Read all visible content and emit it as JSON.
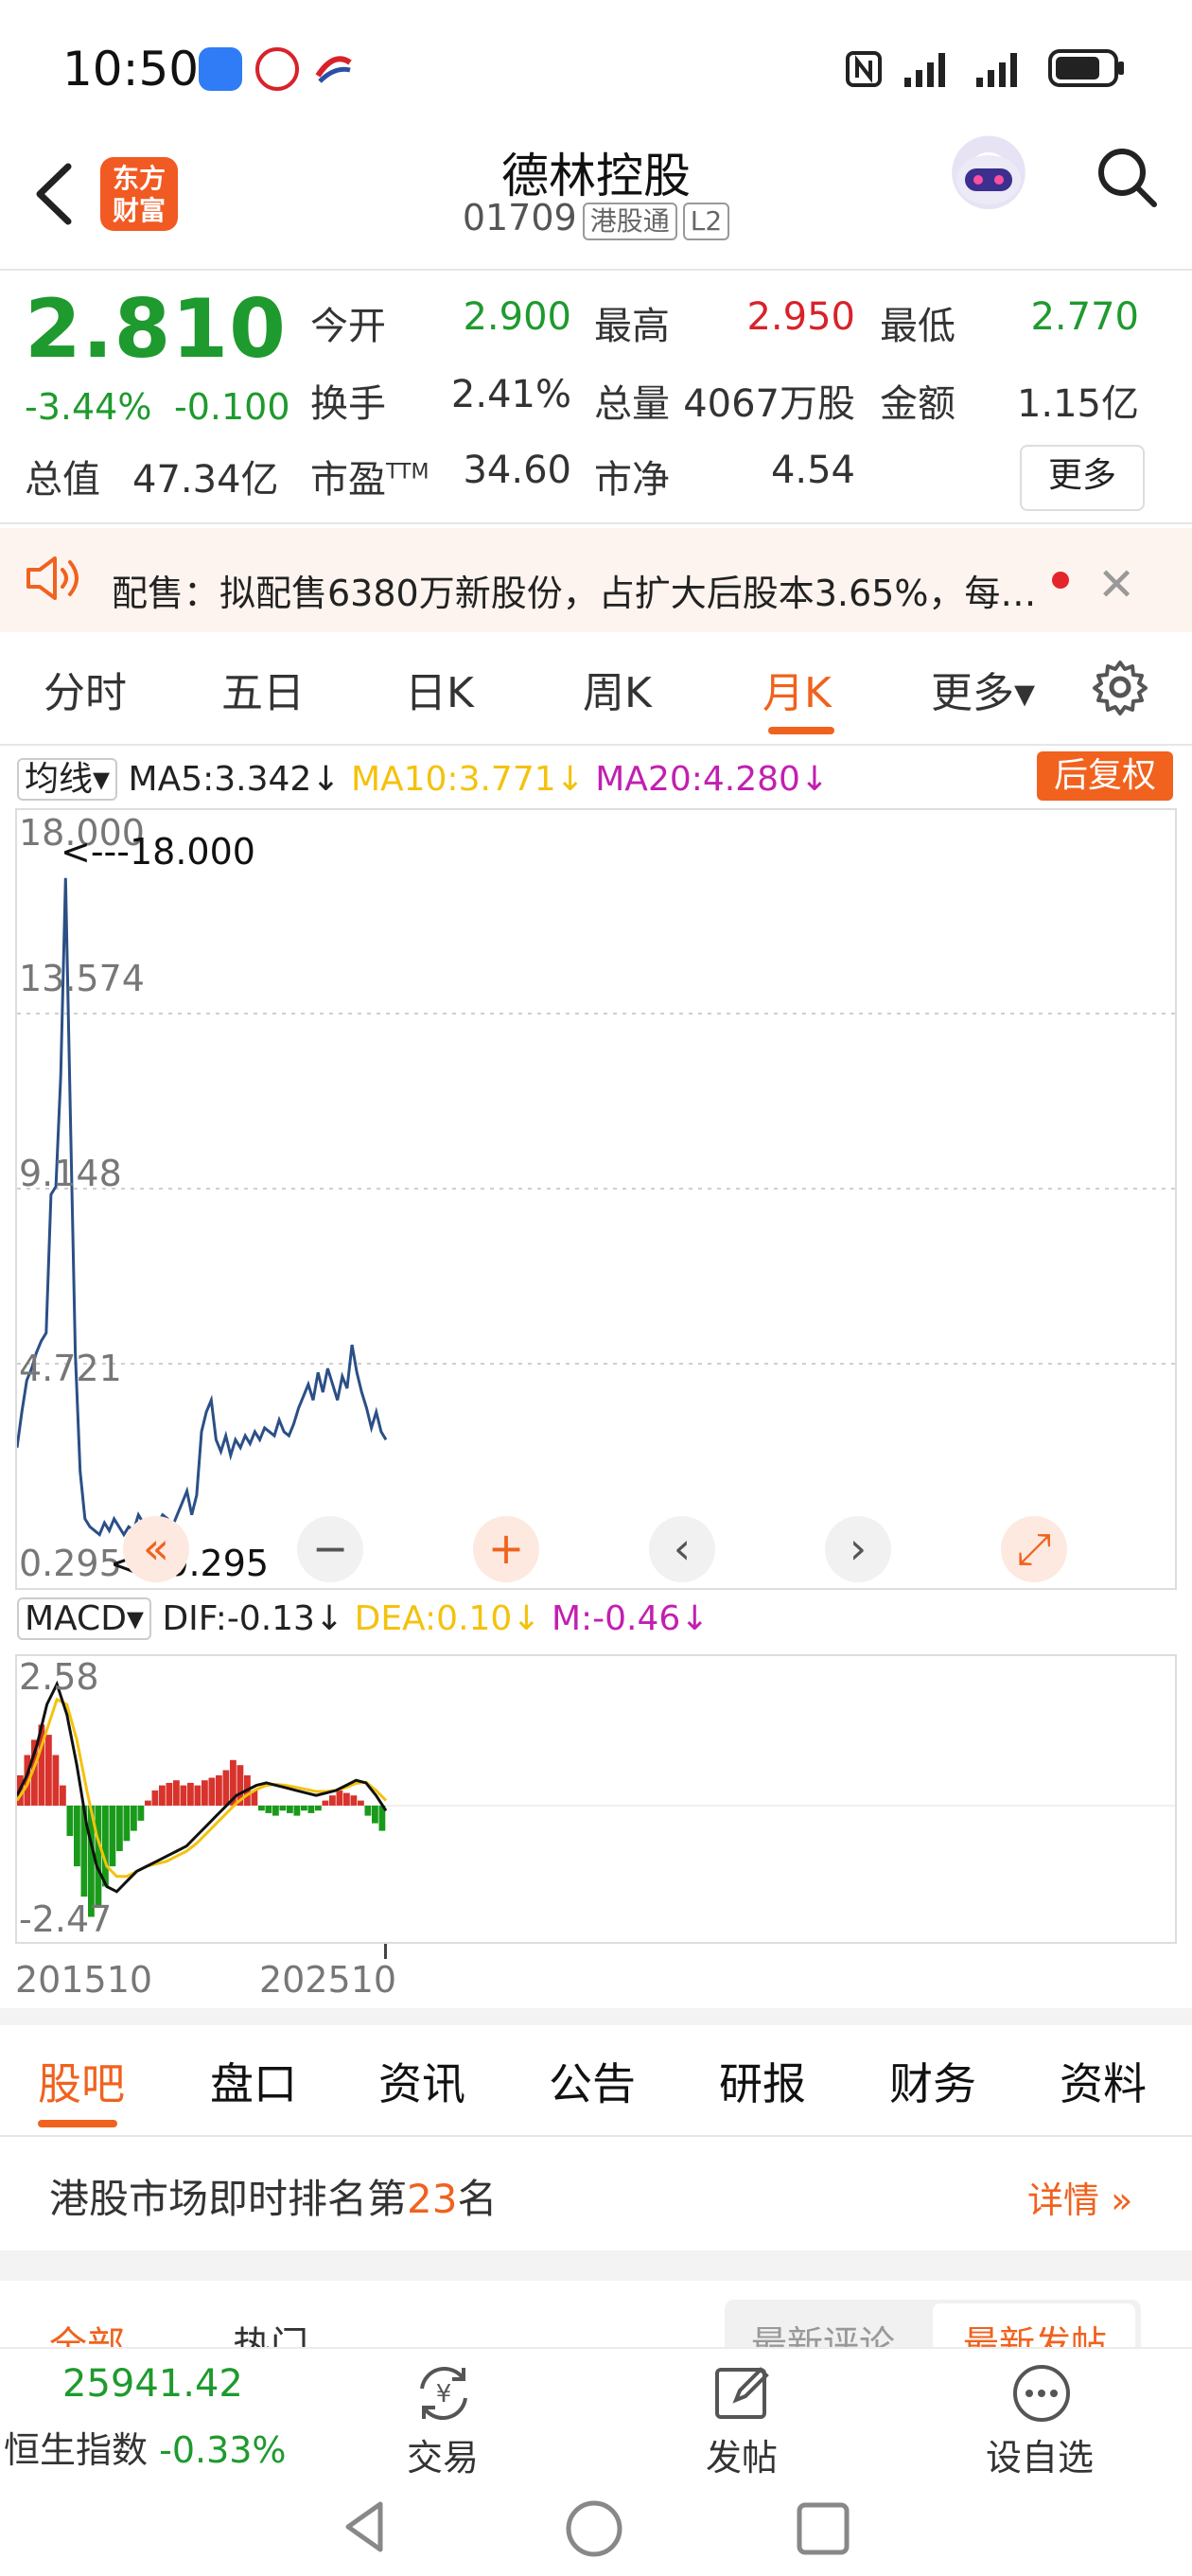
{
  "status_bar": {
    "time": "10:50"
  },
  "header": {
    "logo_line1": "东方",
    "logo_line2": "财富",
    "title": "德林控股",
    "code": "01709",
    "tags": [
      "港股通",
      "L2"
    ]
  },
  "quote": {
    "price": "2.810",
    "change_pct": "-3.44%",
    "change_amt": "-0.100",
    "fields": [
      {
        "label": "今开",
        "value": "2.900",
        "color": "#1e9a2e"
      },
      {
        "label": "最高",
        "value": "2.950",
        "color": "#d8222a"
      },
      {
        "label": "最低",
        "value": "2.770",
        "color": "#1e9a2e"
      },
      {
        "label": "换手",
        "value": "2.41%",
        "color": "#333333"
      },
      {
        "label": "总量",
        "value": "4067万股",
        "color": "#333333"
      },
      {
        "label": "金额",
        "value": "1.15亿",
        "color": "#333333"
      },
      {
        "label": "总值",
        "value": "47.34亿",
        "color": "#333333"
      },
      {
        "label": "市盈",
        "value": "34.60",
        "color": "#333333"
      },
      {
        "label": "市净",
        "value": "4.54",
        "color": "#333333"
      }
    ],
    "pe_sup": "TTM",
    "more": "更多"
  },
  "notice": {
    "text": "配售：拟配售6380万新股份，占扩大后股本3.65%，每…"
  },
  "period_tabs": [
    {
      "label": "分时",
      "active": false
    },
    {
      "label": "五日",
      "active": false
    },
    {
      "label": "日K",
      "active": false
    },
    {
      "label": "周K",
      "active": false
    },
    {
      "label": "月K",
      "active": true
    },
    {
      "label": "更多▾",
      "active": false
    }
  ],
  "ma_row": {
    "selector": "均线▾",
    "ma5": "MA5:3.342↓",
    "ma10": "MA10:3.771↓",
    "ma20": "MA20:4.280↓",
    "adjust": "后复权",
    "colors": {
      "ma5": "#222222",
      "ma10": "#f4c20d",
      "ma20": "#c21fb0"
    }
  },
  "chart_data": [
    {
      "type": "line",
      "title": "月K",
      "ylim": [
        0.295,
        18.0
      ],
      "y_ticks": [
        "18.000",
        "13.574",
        "9.148",
        "4.721",
        "0.295"
      ],
      "max_marker": "<---18.000",
      "min_marker": "<--0.295",
      "x_labels": [
        "201510",
        "202510"
      ],
      "series": [
        {
          "values": [
            2.6,
            3.5,
            4.3,
            4.6,
            5.0,
            5.3,
            5.5,
            9.0,
            9.2,
            12.0,
            17.0,
            11.0,
            5.0,
            2.0,
            0.8,
            0.6,
            0.5,
            0.4,
            0.7,
            0.5,
            0.8,
            0.6,
            0.4,
            0.6,
            0.5,
            0.9,
            0.7,
            0.6,
            0.8,
            0.7,
            0.9,
            0.8,
            0.6,
            0.9,
            1.2,
            1.5,
            0.9,
            1.4,
            3.0,
            3.5,
            3.8,
            2.8,
            2.5,
            2.9,
            2.4,
            2.8,
            2.6,
            2.9,
            2.7,
            3.0,
            2.8,
            3.1,
            3.0,
            2.9,
            3.3,
            3.0,
            2.9,
            3.2,
            3.6,
            3.9,
            4.2,
            3.8,
            4.5,
            4.0,
            4.6,
            4.2,
            3.8,
            4.4,
            4.1,
            5.2,
            4.5,
            4.0,
            3.6,
            3.1,
            3.5,
            3.0,
            2.8
          ]
        }
      ]
    },
    {
      "type": "bar",
      "title": "MACD",
      "ylim": [
        -2.47,
        2.58
      ],
      "y_ticks": [
        "2.58",
        "-2.47"
      ],
      "series": [
        {
          "name": "M",
          "values": [
            0.6,
            1.0,
            1.3,
            1.6,
            1.4,
            1.0,
            0.4,
            -0.6,
            -1.2,
            -1.8,
            -2.2,
            -2.0,
            -1.6,
            -1.2,
            -0.9,
            -0.7,
            -0.5,
            -0.3,
            0.1,
            0.3,
            0.4,
            0.45,
            0.5,
            0.4,
            0.45,
            0.4,
            0.5,
            0.55,
            0.6,
            0.7,
            0.9,
            0.8,
            0.6,
            0.3,
            -0.1,
            -0.15,
            -0.2,
            -0.1,
            -0.15,
            -0.2,
            -0.1,
            -0.15,
            -0.1,
            0.1,
            0.2,
            0.3,
            0.25,
            0.2,
            0.1,
            -0.2,
            -0.35,
            -0.5
          ]
        },
        {
          "name": "DIF",
          "values": [
            0.2,
            0.6,
            1.2,
            2.0,
            2.4,
            1.8,
            0.8,
            -0.4,
            -1.2,
            -1.6,
            -1.7,
            -1.5,
            -1.3,
            -1.2,
            -1.1,
            -1.0,
            -0.9,
            -0.8,
            -0.6,
            -0.4,
            -0.2,
            0.0,
            0.2,
            0.3,
            0.4,
            0.45,
            0.4,
            0.35,
            0.3,
            0.25,
            0.2,
            0.25,
            0.3,
            0.4,
            0.5,
            0.45,
            0.2,
            -0.1
          ]
        },
        {
          "name": "DEA",
          "values": [
            0.1,
            0.4,
            0.9,
            1.5,
            2.1,
            2.0,
            1.3,
            0.3,
            -0.6,
            -1.2,
            -1.4,
            -1.4,
            -1.3,
            -1.2,
            -1.15,
            -1.1,
            -1.0,
            -0.9,
            -0.75,
            -0.55,
            -0.35,
            -0.15,
            0.05,
            0.2,
            0.32,
            0.4,
            0.42,
            0.4,
            0.36,
            0.32,
            0.28,
            0.28,
            0.3,
            0.36,
            0.44,
            0.46,
            0.3,
            0.1
          ]
        }
      ]
    }
  ],
  "macd_row": {
    "selector": "MACD▾",
    "dif": "DIF:-0.13↓",
    "dea": "DEA:0.10↓",
    "m": "M:-0.46↓"
  },
  "section_tabs": [
    {
      "label": "股吧",
      "active": true
    },
    {
      "label": "盘口",
      "active": false
    },
    {
      "label": "资讯",
      "active": false
    },
    {
      "label": "公告",
      "active": false
    },
    {
      "label": "研报",
      "active": false
    },
    {
      "label": "财务",
      "active": false
    },
    {
      "label": "资料",
      "active": false
    }
  ],
  "rank": {
    "prefix": "港股市场即时排名第",
    "num": "23",
    "suffix": "名",
    "detail": "详情"
  },
  "sub_tabs": {
    "left": [
      "全部",
      "热门"
    ],
    "right": [
      "最新评论",
      "最新发帖"
    ]
  },
  "bottom_bar": {
    "index_value": "25941.42",
    "index_name": "恒生指数",
    "index_change": "-0.33%",
    "buttons": [
      "交易",
      "发帖",
      "设自选"
    ]
  }
}
